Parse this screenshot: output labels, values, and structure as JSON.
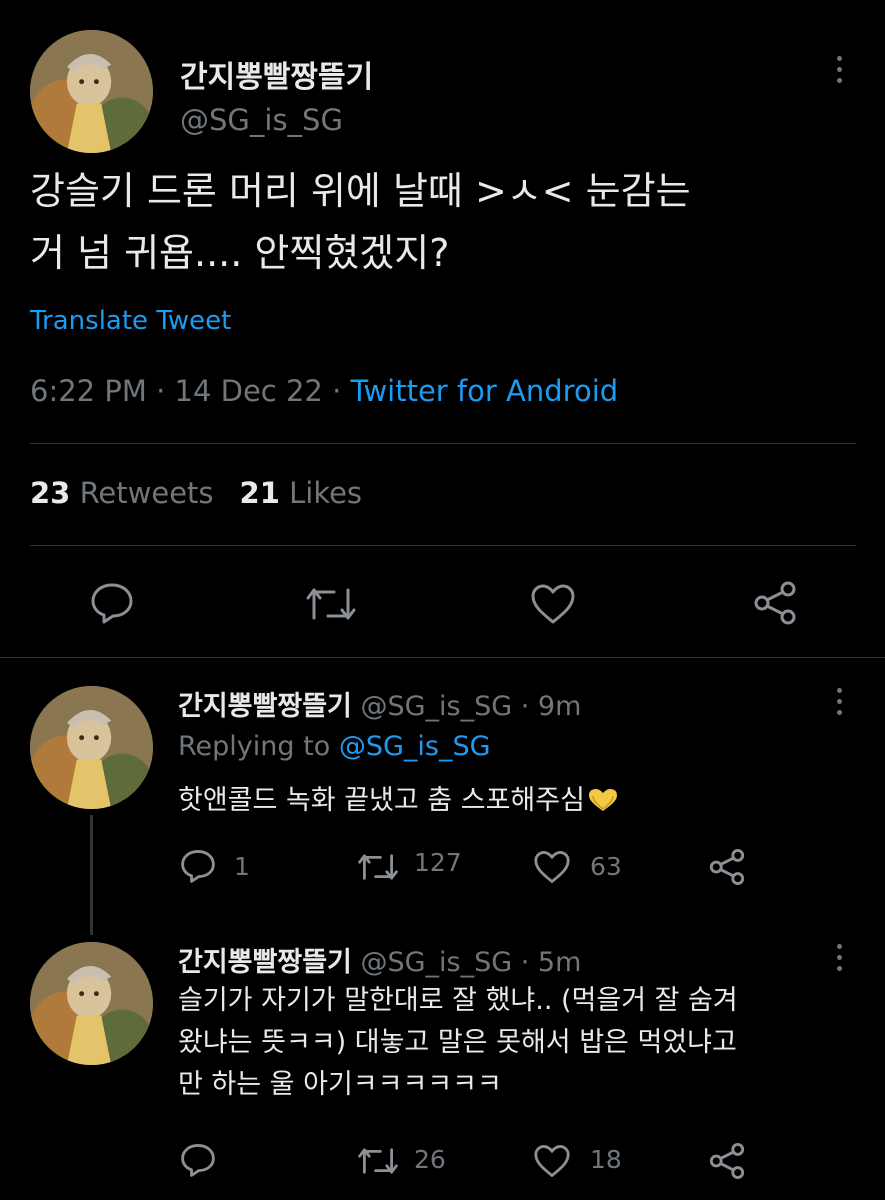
{
  "main_tweet": {
    "display_name": "간지뽕빨짱뜰기",
    "handle": "@SG_is_SG",
    "text_line1": "강슬기 드론 머리 위에 날때 >ㅅ< 눈감는",
    "text_line2": "거 넘 귀욥.... 안찍혔겠지?",
    "translate_label": "Translate Tweet",
    "time": "6:22 PM",
    "sep1": " · ",
    "date": "14 Dec 22",
    "sep2": " · ",
    "source": "Twitter for Android",
    "retweets_count": "23",
    "retweets_label": "Retweets",
    "likes_count": "21",
    "likes_label": "Likes"
  },
  "replies": [
    {
      "display_name": "간지뽕빨짱뜰기",
      "handle_time": "@SG_is_SG · 9m",
      "replying_prefix": "Replying to ",
      "replying_mention": "@SG_is_SG",
      "text_line1": "핫앤콜드 녹화 끝냈고 춤 스포해주심",
      "reply_count": "1",
      "retweet_count": "127",
      "like_count": "63"
    },
    {
      "display_name": "간지뽕빨짱뜰기",
      "handle_time": "@SG_is_SG · 5m",
      "text_line1": "슬기가 자기가 말한대로 잘 했냐.. (먹을거 잘 숨겨",
      "text_line2": "왔냐는 뜻ㅋㅋ) 대놓고 말은 못해서 밥은 먹었냐고",
      "text_line3": "만 하는 울 아기ㅋㅋㅋㅋㅋㅋ",
      "retweet_count": "26",
      "like_count": "18"
    }
  ],
  "colors": {
    "background": "#000000",
    "text": "#e7e9ea",
    "secondary": "#71767b",
    "link": "#1d9bf0",
    "divider": "#2f3336",
    "heart_emoji": "#f5c842"
  },
  "icons": [
    "reply-icon",
    "retweet-icon",
    "like-icon",
    "share-icon",
    "more-icon",
    "yellow-heart-emoji"
  ]
}
